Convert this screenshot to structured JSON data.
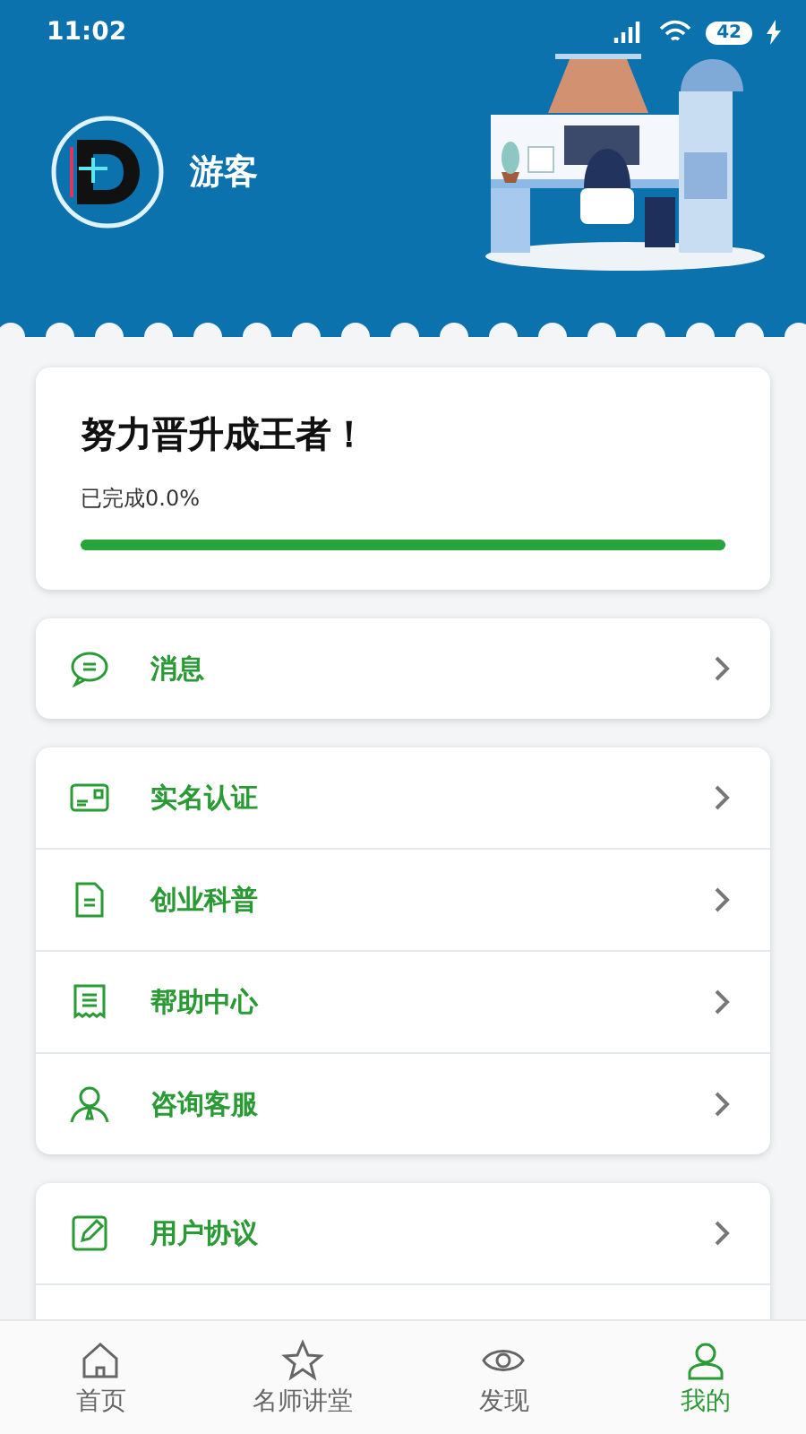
{
  "status_bar": {
    "time": "11:02",
    "battery": "42"
  },
  "profile": {
    "name": "游客"
  },
  "progress": {
    "title": "努力晋升成王者！",
    "caption": "已完成0.0%",
    "level": 1
  },
  "menu_groups": [
    {
      "items": [
        {
          "label": "消息",
          "kind": "chat"
        }
      ]
    },
    {
      "items": [
        {
          "label": "实名认证",
          "kind": "card"
        },
        {
          "label": "创业科普",
          "kind": "doc"
        },
        {
          "label": "帮助中心",
          "kind": "receipt"
        },
        {
          "label": "咨询客服",
          "kind": "person"
        }
      ]
    },
    {
      "items": [
        {
          "label": "用户协议",
          "kind": "edit"
        }
      ]
    }
  ],
  "tabs": [
    {
      "label": "首页",
      "kind": "home",
      "selected": false
    },
    {
      "label": "名师讲堂",
      "kind": "star",
      "selected": false
    },
    {
      "label": "发现",
      "kind": "eye",
      "selected": false
    },
    {
      "label": "我的",
      "kind": "user",
      "selected": true
    }
  ]
}
